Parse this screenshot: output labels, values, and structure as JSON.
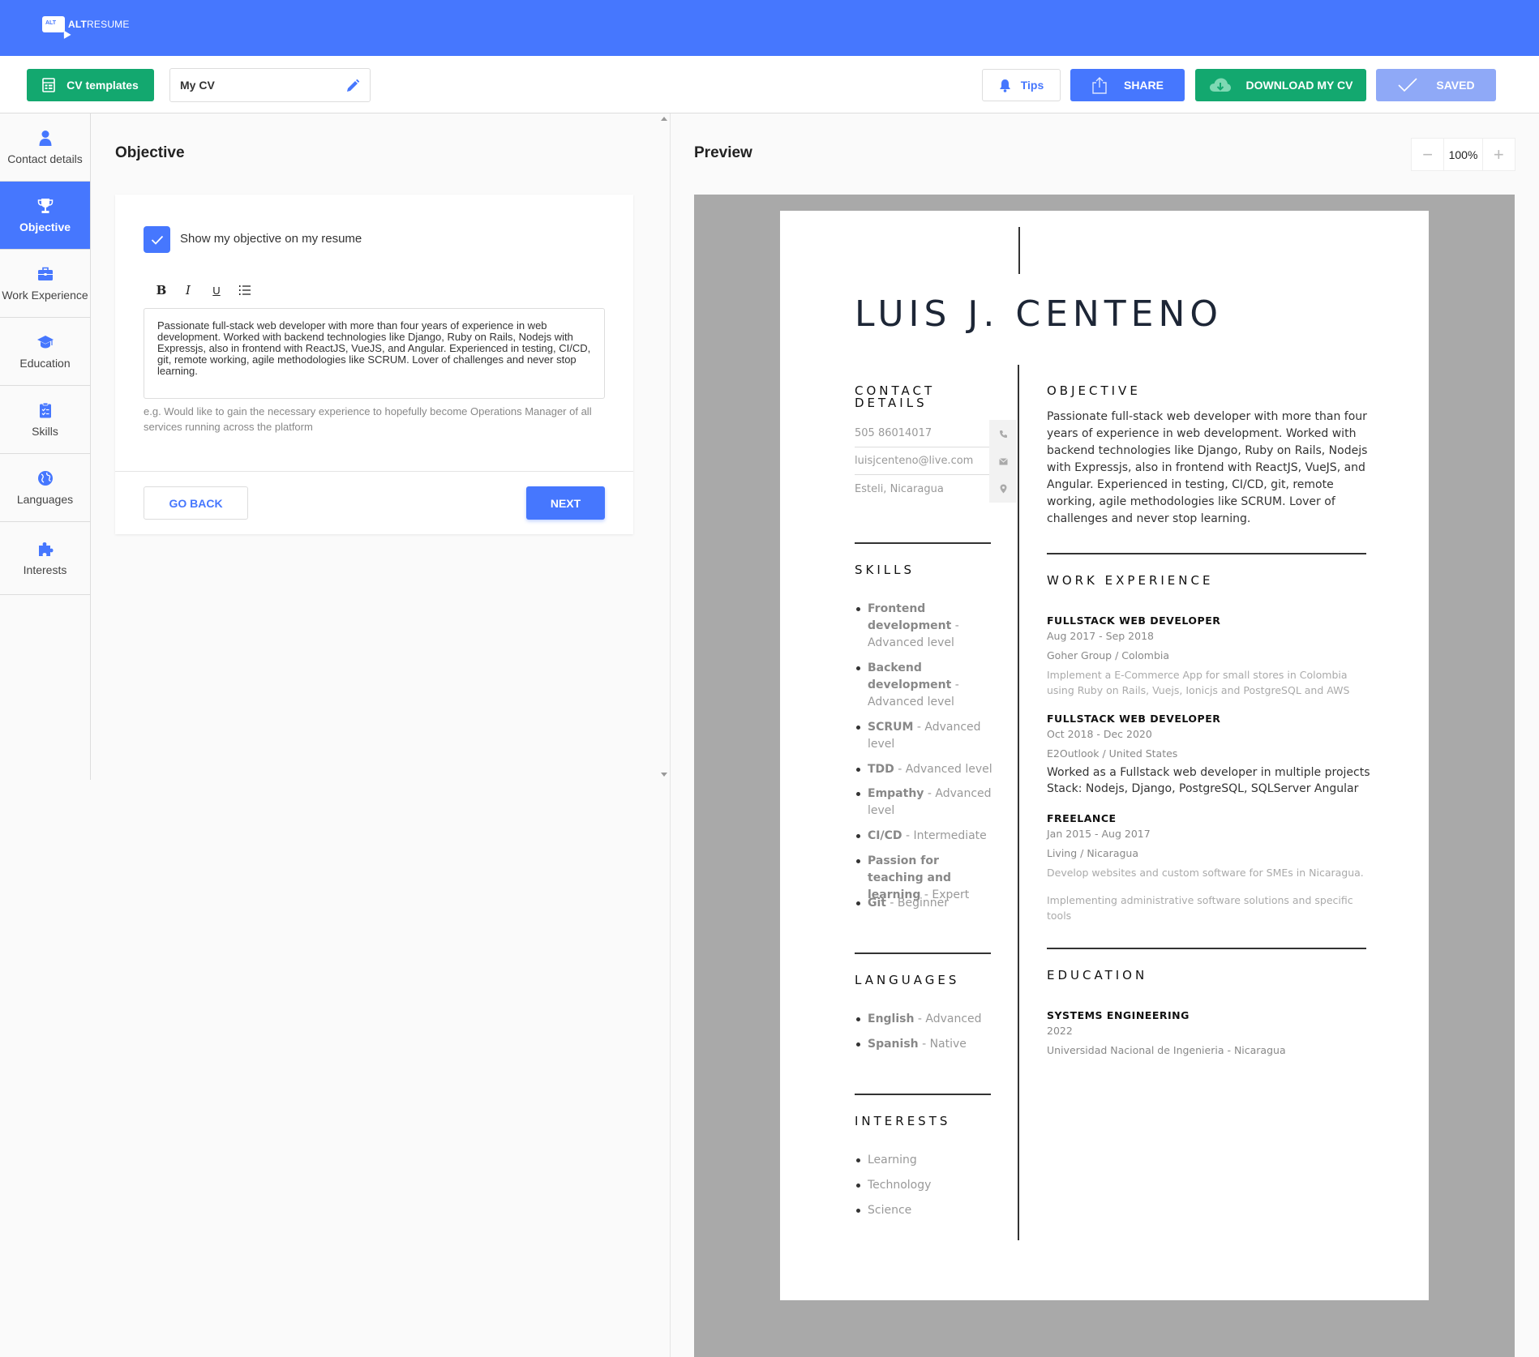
{
  "brand": {
    "logo_badge": "ALT",
    "alt": "ALT",
    "resume": "RESUME"
  },
  "toolbar": {
    "templates_label": "CV templates",
    "cv_name": "My CV",
    "tips_label": "Tips",
    "share_label": "SHARE",
    "download_label": "DOWNLOAD MY CV",
    "saved_label": "SAVED"
  },
  "sidebar": {
    "items": [
      {
        "label": "Contact details",
        "icon": "person-icon"
      },
      {
        "label": "Objective",
        "icon": "trophy-icon",
        "active": true
      },
      {
        "label": "Work Experience",
        "icon": "briefcase-icon"
      },
      {
        "label": "Education",
        "icon": "graduation-cap-icon"
      },
      {
        "label": "Skills",
        "icon": "clipboard-icon"
      },
      {
        "label": "Languages",
        "icon": "globe-icon"
      },
      {
        "label": "Interests",
        "icon": "puzzle-icon"
      }
    ]
  },
  "editor": {
    "title": "Objective",
    "show_objective_label": "Show my objective on my resume",
    "show_objective_checked": true,
    "format_buttons": [
      "B",
      "I",
      "U",
      "list"
    ],
    "objective_text": "Passionate full-stack web developer with more than four years of experience in web development. Worked with backend technologies like Django, Ruby on Rails, Nodejs with Expressjs, also in frontend with ReactJS, VueJS, and Angular. Experienced in testing, CI/CD, git, remote working, agile methodologies like SCRUM. Lover of challenges and never stop learning.",
    "hint": "e.g. Would like to gain the necessary experience to hopefully become Operations Manager of all services running across the platform",
    "back_label": "GO BACK",
    "next_label": "NEXT"
  },
  "preview": {
    "title": "Preview",
    "zoom": "100%",
    "zoom_minus": "−",
    "zoom_plus": "+"
  },
  "resume": {
    "name": "LUIS J. CENTENO",
    "contact_heading_1": "CONTACT",
    "contact_heading_2": "DETAILS",
    "phone": "505 86014017",
    "email": "luisjcenteno@live.com",
    "location": "Esteli, Nicaragua",
    "skills_heading": "SKILLS",
    "skills": [
      {
        "name": "Frontend development",
        "level": " - Advanced level"
      },
      {
        "name": "Backend development",
        "level": " - Advanced level"
      },
      {
        "name": "SCRUM",
        "level": " - Advanced level"
      },
      {
        "name": "TDD",
        "level": " - Advanced level"
      },
      {
        "name": "Empathy",
        "level": " - Advanced level"
      },
      {
        "name": "CI/CD",
        "level": " - Intermediate"
      },
      {
        "name": "Passion for teaching and learning",
        "level": " - Expert"
      },
      {
        "name": "Git",
        "level": " - Beginner"
      }
    ],
    "languages_heading": "LANGUAGES",
    "languages": [
      {
        "name": "English",
        "level": " - Advanced"
      },
      {
        "name": "Spanish",
        "level": " - Native"
      }
    ],
    "interests_heading": "INTERESTS",
    "interests": [
      "Learning",
      "Technology",
      "Science"
    ],
    "objective_heading": "OBJECTIVE",
    "objective": "Passionate full-stack web developer with more than four years of experience in web development. Worked with backend technologies like Django, Ruby on Rails, Nodejs with Expressjs, also in frontend with ReactJS, VueJS, and Angular. Experienced in testing, CI/CD, git, remote working, agile methodologies like SCRUM. Lover of challenges and never stop learning.",
    "work_heading": "WORK EXPERIENCE",
    "jobs": [
      {
        "title": "FULLSTACK WEB DEVELOPER",
        "dates": "Aug 2017 - Sep 2018",
        "company": "Goher Group / Colombia",
        "desc": "Implement a E-Commerce App for small stores in Colombia using Ruby on Rails, Vuejs, Ionicjs and PostgreSQL and AWS"
      },
      {
        "title": "FULLSTACK WEB DEVELOPER",
        "dates": "Oct 2018 - Dec 2020",
        "company": "E2Outlook / United States",
        "desc": "Worked as a Fullstack web developer in multiple projects Stack: Nodejs, Django, PostgreSQL, SQLServer Angular"
      },
      {
        "title": "FREELANCE",
        "dates": "Jan 2015 - Aug 2017",
        "company": "Living / Nicaragua",
        "desc": "Develop websites and custom software for SMEs in Nicaragua.",
        "desc2": "Implementing administrative software solutions and specific tools"
      }
    ],
    "education_heading": "EDUCATION",
    "degree": "SYSTEMS ENGINEERING",
    "degree_year": "2022",
    "school": "Universidad Nacional de Ingenieria - Nicaragua"
  },
  "colors": {
    "primary": "#4677fe",
    "green": "#13a86f",
    "saved": "#8fa9f7",
    "viewer_bg": "#a9a9a9"
  }
}
